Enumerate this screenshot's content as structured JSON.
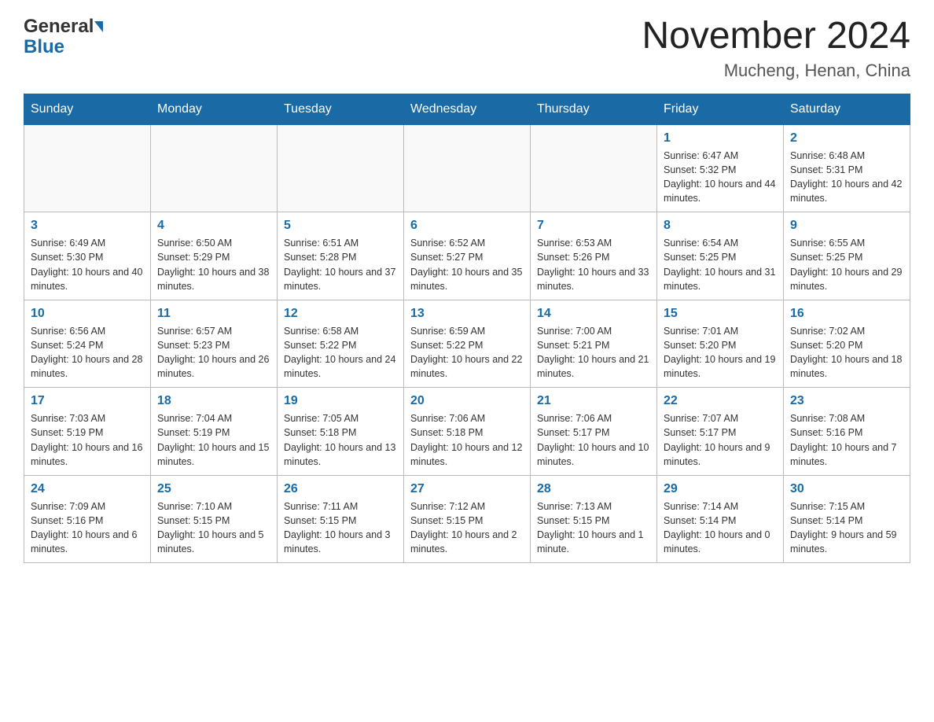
{
  "header": {
    "logo_general": "General",
    "logo_blue": "Blue",
    "month_title": "November 2024",
    "location": "Mucheng, Henan, China"
  },
  "days_of_week": [
    "Sunday",
    "Monday",
    "Tuesday",
    "Wednesday",
    "Thursday",
    "Friday",
    "Saturday"
  ],
  "weeks": [
    [
      {
        "day": "",
        "info": ""
      },
      {
        "day": "",
        "info": ""
      },
      {
        "day": "",
        "info": ""
      },
      {
        "day": "",
        "info": ""
      },
      {
        "day": "",
        "info": ""
      },
      {
        "day": "1",
        "info": "Sunrise: 6:47 AM\nSunset: 5:32 PM\nDaylight: 10 hours and 44 minutes."
      },
      {
        "day": "2",
        "info": "Sunrise: 6:48 AM\nSunset: 5:31 PM\nDaylight: 10 hours and 42 minutes."
      }
    ],
    [
      {
        "day": "3",
        "info": "Sunrise: 6:49 AM\nSunset: 5:30 PM\nDaylight: 10 hours and 40 minutes."
      },
      {
        "day": "4",
        "info": "Sunrise: 6:50 AM\nSunset: 5:29 PM\nDaylight: 10 hours and 38 minutes."
      },
      {
        "day": "5",
        "info": "Sunrise: 6:51 AM\nSunset: 5:28 PM\nDaylight: 10 hours and 37 minutes."
      },
      {
        "day": "6",
        "info": "Sunrise: 6:52 AM\nSunset: 5:27 PM\nDaylight: 10 hours and 35 minutes."
      },
      {
        "day": "7",
        "info": "Sunrise: 6:53 AM\nSunset: 5:26 PM\nDaylight: 10 hours and 33 minutes."
      },
      {
        "day": "8",
        "info": "Sunrise: 6:54 AM\nSunset: 5:25 PM\nDaylight: 10 hours and 31 minutes."
      },
      {
        "day": "9",
        "info": "Sunrise: 6:55 AM\nSunset: 5:25 PM\nDaylight: 10 hours and 29 minutes."
      }
    ],
    [
      {
        "day": "10",
        "info": "Sunrise: 6:56 AM\nSunset: 5:24 PM\nDaylight: 10 hours and 28 minutes."
      },
      {
        "day": "11",
        "info": "Sunrise: 6:57 AM\nSunset: 5:23 PM\nDaylight: 10 hours and 26 minutes."
      },
      {
        "day": "12",
        "info": "Sunrise: 6:58 AM\nSunset: 5:22 PM\nDaylight: 10 hours and 24 minutes."
      },
      {
        "day": "13",
        "info": "Sunrise: 6:59 AM\nSunset: 5:22 PM\nDaylight: 10 hours and 22 minutes."
      },
      {
        "day": "14",
        "info": "Sunrise: 7:00 AM\nSunset: 5:21 PM\nDaylight: 10 hours and 21 minutes."
      },
      {
        "day": "15",
        "info": "Sunrise: 7:01 AM\nSunset: 5:20 PM\nDaylight: 10 hours and 19 minutes."
      },
      {
        "day": "16",
        "info": "Sunrise: 7:02 AM\nSunset: 5:20 PM\nDaylight: 10 hours and 18 minutes."
      }
    ],
    [
      {
        "day": "17",
        "info": "Sunrise: 7:03 AM\nSunset: 5:19 PM\nDaylight: 10 hours and 16 minutes."
      },
      {
        "day": "18",
        "info": "Sunrise: 7:04 AM\nSunset: 5:19 PM\nDaylight: 10 hours and 15 minutes."
      },
      {
        "day": "19",
        "info": "Sunrise: 7:05 AM\nSunset: 5:18 PM\nDaylight: 10 hours and 13 minutes."
      },
      {
        "day": "20",
        "info": "Sunrise: 7:06 AM\nSunset: 5:18 PM\nDaylight: 10 hours and 12 minutes."
      },
      {
        "day": "21",
        "info": "Sunrise: 7:06 AM\nSunset: 5:17 PM\nDaylight: 10 hours and 10 minutes."
      },
      {
        "day": "22",
        "info": "Sunrise: 7:07 AM\nSunset: 5:17 PM\nDaylight: 10 hours and 9 minutes."
      },
      {
        "day": "23",
        "info": "Sunrise: 7:08 AM\nSunset: 5:16 PM\nDaylight: 10 hours and 7 minutes."
      }
    ],
    [
      {
        "day": "24",
        "info": "Sunrise: 7:09 AM\nSunset: 5:16 PM\nDaylight: 10 hours and 6 minutes."
      },
      {
        "day": "25",
        "info": "Sunrise: 7:10 AM\nSunset: 5:15 PM\nDaylight: 10 hours and 5 minutes."
      },
      {
        "day": "26",
        "info": "Sunrise: 7:11 AM\nSunset: 5:15 PM\nDaylight: 10 hours and 3 minutes."
      },
      {
        "day": "27",
        "info": "Sunrise: 7:12 AM\nSunset: 5:15 PM\nDaylight: 10 hours and 2 minutes."
      },
      {
        "day": "28",
        "info": "Sunrise: 7:13 AM\nSunset: 5:15 PM\nDaylight: 10 hours and 1 minute."
      },
      {
        "day": "29",
        "info": "Sunrise: 7:14 AM\nSunset: 5:14 PM\nDaylight: 10 hours and 0 minutes."
      },
      {
        "day": "30",
        "info": "Sunrise: 7:15 AM\nSunset: 5:14 PM\nDaylight: 9 hours and 59 minutes."
      }
    ]
  ]
}
